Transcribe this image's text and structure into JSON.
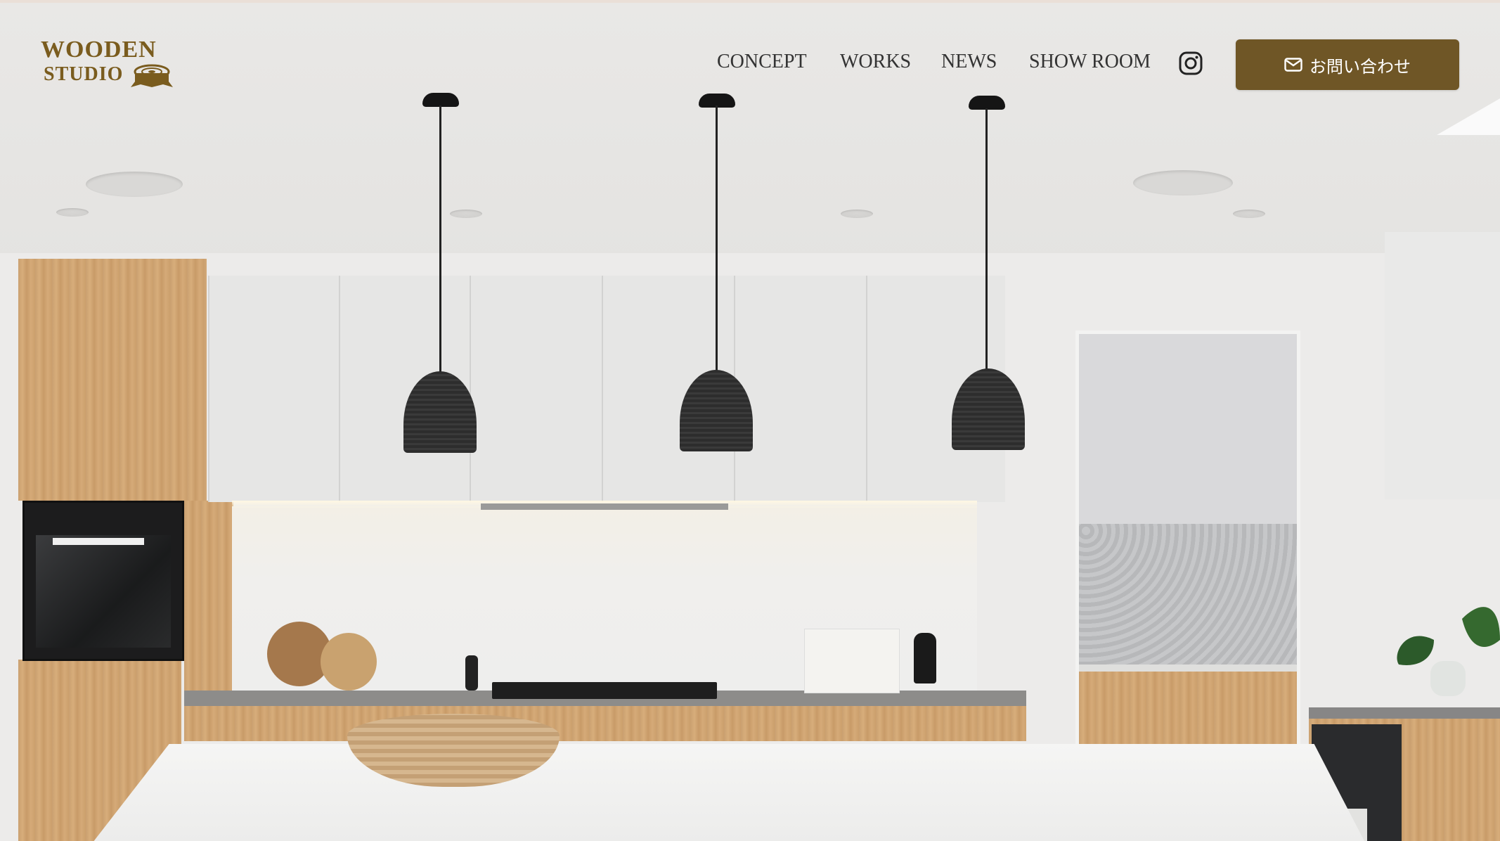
{
  "logo": {
    "line1": "WOODEN",
    "line2": "STUDIO"
  },
  "nav": {
    "items": [
      {
        "label": "CONCEPT"
      },
      {
        "label": "WORKS"
      },
      {
        "label": "NEWS"
      },
      {
        "label": "SHOW ROOM"
      }
    ],
    "instagram_icon": "instagram-icon"
  },
  "cta": {
    "label": "お問い合わせ",
    "icon": "mail-icon"
  },
  "colors": {
    "accent": "#6f5626",
    "logo": "#7a5c1e",
    "nav_text": "#333333"
  }
}
